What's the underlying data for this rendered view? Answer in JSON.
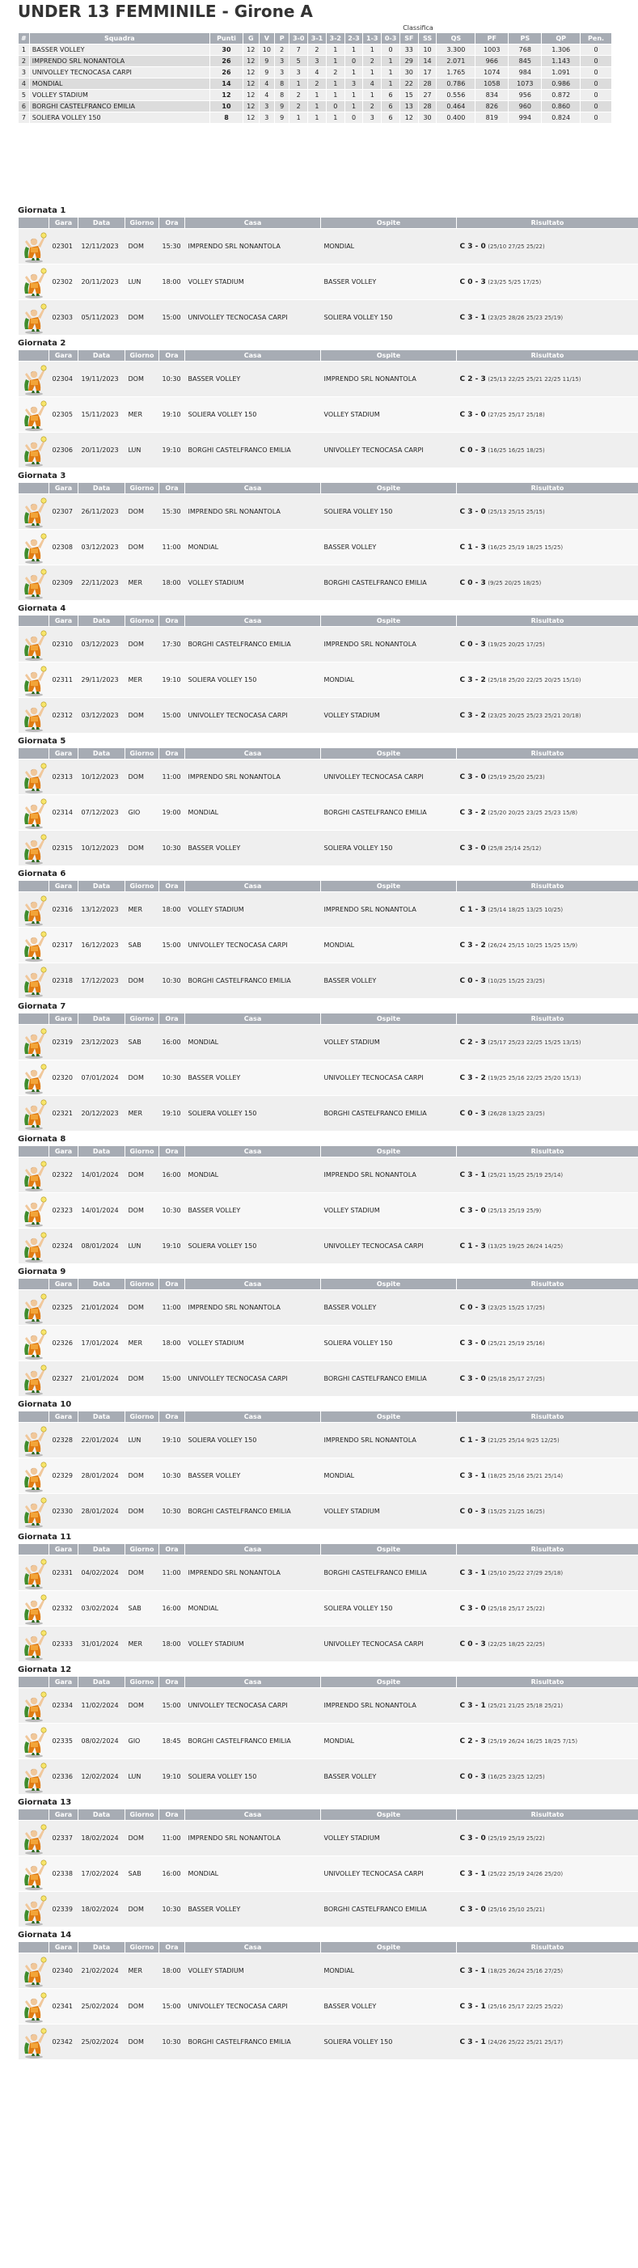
{
  "title": "UNDER 13 FEMMINILE - Girone A",
  "classifica_label": "Classifica",
  "standings_headers": [
    "#",
    "Squadra",
    "Punti",
    "G",
    "V",
    "P",
    "3-0",
    "3-1",
    "3-2",
    "2-3",
    "1-3",
    "0-3",
    "SF",
    "SS",
    "QS",
    "PF",
    "PS",
    "QP",
    "Pen."
  ],
  "standings": [
    [
      "1",
      "BASSER VOLLEY",
      "30",
      "12",
      "10",
      "2",
      "7",
      "2",
      "1",
      "1",
      "1",
      "0",
      "33",
      "10",
      "3.300",
      "1003",
      "768",
      "1.306",
      "0"
    ],
    [
      "2",
      "IMPRENDO SRL NONANTOLA",
      "26",
      "12",
      "9",
      "3",
      "5",
      "3",
      "1",
      "0",
      "2",
      "1",
      "29",
      "14",
      "2.071",
      "966",
      "845",
      "1.143",
      "0"
    ],
    [
      "3",
      "UNIVOLLEY TECNOCASA CARPI",
      "26",
      "12",
      "9",
      "3",
      "3",
      "4",
      "2",
      "1",
      "1",
      "1",
      "30",
      "17",
      "1.765",
      "1074",
      "984",
      "1.091",
      "0"
    ],
    [
      "4",
      "MONDIAL",
      "14",
      "12",
      "4",
      "8",
      "1",
      "2",
      "1",
      "3",
      "4",
      "1",
      "22",
      "28",
      "0.786",
      "1058",
      "1073",
      "0.986",
      "0"
    ],
    [
      "5",
      "VOLLEY STADIUM",
      "12",
      "12",
      "4",
      "8",
      "2",
      "1",
      "1",
      "1",
      "1",
      "6",
      "15",
      "27",
      "0.556",
      "834",
      "956",
      "0.872",
      "0"
    ],
    [
      "6",
      "BORGHI CASTELFRANCO EMILIA",
      "10",
      "12",
      "3",
      "9",
      "2",
      "1",
      "0",
      "1",
      "2",
      "6",
      "13",
      "28",
      "0.464",
      "826",
      "960",
      "0.860",
      "0"
    ],
    [
      "7",
      "SOLIERA VOLLEY 150",
      "8",
      "12",
      "3",
      "9",
      "1",
      "1",
      "1",
      "0",
      "3",
      "6",
      "12",
      "30",
      "0.400",
      "819",
      "994",
      "0.824",
      "0"
    ]
  ],
  "game_headers": [
    "Gara",
    "Data",
    "Giorno",
    "Ora",
    "Casa",
    "Ospite",
    "Risultato"
  ],
  "icon": "volleyball-player-icon",
  "rounds": [
    {
      "title": "Giornata 1",
      "games": [
        [
          "02301",
          "12/11/2023",
          "DOM",
          "15:30",
          "IMPRENDO SRL NONANTOLA",
          "MONDIAL",
          "C 3 - 0",
          "(25/10 27/25 25/22)"
        ],
        [
          "02302",
          "20/11/2023",
          "LUN",
          "18:00",
          "VOLLEY STADIUM",
          "BASSER VOLLEY",
          "C 0 - 3",
          "(23/25 5/25 17/25)"
        ],
        [
          "02303",
          "05/11/2023",
          "DOM",
          "15:00",
          "UNIVOLLEY TECNOCASA CARPI",
          "SOLIERA VOLLEY 150",
          "C 3 - 1",
          "(23/25 28/26 25/23 25/19)"
        ]
      ]
    },
    {
      "title": "Giornata 2",
      "games": [
        [
          "02304",
          "19/11/2023",
          "DOM",
          "10:30",
          "BASSER VOLLEY",
          "IMPRENDO SRL NONANTOLA",
          "C 2 - 3",
          "(25/13 22/25 25/21 22/25 11/15)"
        ],
        [
          "02305",
          "15/11/2023",
          "MER",
          "19:10",
          "SOLIERA VOLLEY 150",
          "VOLLEY STADIUM",
          "C 3 - 0",
          "(27/25 25/17 25/18)"
        ],
        [
          "02306",
          "20/11/2023",
          "LUN",
          "19:10",
          "BORGHI CASTELFRANCO EMILIA",
          "UNIVOLLEY TECNOCASA CARPI",
          "C 0 - 3",
          "(16/25 16/25 18/25)"
        ]
      ]
    },
    {
      "title": "Giornata 3",
      "games": [
        [
          "02307",
          "26/11/2023",
          "DOM",
          "15:30",
          "IMPRENDO SRL NONANTOLA",
          "SOLIERA VOLLEY 150",
          "C 3 - 0",
          "(25/13 25/15 25/15)"
        ],
        [
          "02308",
          "03/12/2023",
          "DOM",
          "11:00",
          "MONDIAL",
          "BASSER VOLLEY",
          "C 1 - 3",
          "(16/25 25/19 18/25 15/25)"
        ],
        [
          "02309",
          "22/11/2023",
          "MER",
          "18:00",
          "VOLLEY STADIUM",
          "BORGHI CASTELFRANCO EMILIA",
          "C 0 - 3",
          "(9/25 20/25 18/25)"
        ]
      ]
    },
    {
      "title": "Giornata 4",
      "games": [
        [
          "02310",
          "03/12/2023",
          "DOM",
          "17:30",
          "BORGHI CASTELFRANCO EMILIA",
          "IMPRENDO SRL NONANTOLA",
          "C 0 - 3",
          "(19/25 20/25 17/25)"
        ],
        [
          "02311",
          "29/11/2023",
          "MER",
          "19:10",
          "SOLIERA VOLLEY 150",
          "MONDIAL",
          "C 3 - 2",
          "(25/18 25/20 22/25 20/25 15/10)"
        ],
        [
          "02312",
          "03/12/2023",
          "DOM",
          "15:00",
          "UNIVOLLEY TECNOCASA CARPI",
          "VOLLEY STADIUM",
          "C 3 - 2",
          "(23/25 20/25 25/23 25/21 20/18)"
        ]
      ]
    },
    {
      "title": "Giornata 5",
      "games": [
        [
          "02313",
          "10/12/2023",
          "DOM",
          "11:00",
          "IMPRENDO SRL NONANTOLA",
          "UNIVOLLEY TECNOCASA CARPI",
          "C 3 - 0",
          "(25/19 25/20 25/23)"
        ],
        [
          "02314",
          "07/12/2023",
          "GIO",
          "19:00",
          "MONDIAL",
          "BORGHI CASTELFRANCO EMILIA",
          "C 3 - 2",
          "(25/20 20/25 23/25 25/23 15/8)"
        ],
        [
          "02315",
          "10/12/2023",
          "DOM",
          "10:30",
          "BASSER VOLLEY",
          "SOLIERA VOLLEY 150",
          "C 3 - 0",
          "(25/8 25/14 25/12)"
        ]
      ]
    },
    {
      "title": "Giornata 6",
      "games": [
        [
          "02316",
          "13/12/2023",
          "MER",
          "18:00",
          "VOLLEY STADIUM",
          "IMPRENDO SRL NONANTOLA",
          "C 1 - 3",
          "(25/14 18/25 13/25 10/25)"
        ],
        [
          "02317",
          "16/12/2023",
          "SAB",
          "15:00",
          "UNIVOLLEY TECNOCASA CARPI",
          "MONDIAL",
          "C 3 - 2",
          "(26/24 25/15 10/25 15/25 15/9)"
        ],
        [
          "02318",
          "17/12/2023",
          "DOM",
          "10:30",
          "BORGHI CASTELFRANCO EMILIA",
          "BASSER VOLLEY",
          "C 0 - 3",
          "(10/25 15/25 23/25)"
        ]
      ]
    },
    {
      "title": "Giornata 7",
      "games": [
        [
          "02319",
          "23/12/2023",
          "SAB",
          "16:00",
          "MONDIAL",
          "VOLLEY STADIUM",
          "C 2 - 3",
          "(25/17 25/23 22/25 15/25 13/15)"
        ],
        [
          "02320",
          "07/01/2024",
          "DOM",
          "10:30",
          "BASSER VOLLEY",
          "UNIVOLLEY TECNOCASA CARPI",
          "C 3 - 2",
          "(19/25 25/16 22/25 25/20 15/13)"
        ],
        [
          "02321",
          "20/12/2023",
          "MER",
          "19:10",
          "SOLIERA VOLLEY 150",
          "BORGHI CASTELFRANCO EMILIA",
          "C 0 - 3",
          "(26/28 13/25 23/25)"
        ]
      ]
    },
    {
      "title": "Giornata 8",
      "games": [
        [
          "02322",
          "14/01/2024",
          "DOM",
          "16:00",
          "MONDIAL",
          "IMPRENDO SRL NONANTOLA",
          "C 3 - 1",
          "(25/21 15/25 25/19 25/14)"
        ],
        [
          "02323",
          "14/01/2024",
          "DOM",
          "10:30",
          "BASSER VOLLEY",
          "VOLLEY STADIUM",
          "C 3 - 0",
          "(25/13 25/19 25/9)"
        ],
        [
          "02324",
          "08/01/2024",
          "LUN",
          "19:10",
          "SOLIERA VOLLEY 150",
          "UNIVOLLEY TECNOCASA CARPI",
          "C 1 - 3",
          "(13/25 19/25 26/24 14/25)"
        ]
      ]
    },
    {
      "title": "Giornata 9",
      "games": [
        [
          "02325",
          "21/01/2024",
          "DOM",
          "11:00",
          "IMPRENDO SRL NONANTOLA",
          "BASSER VOLLEY",
          "C 0 - 3",
          "(23/25 15/25 17/25)"
        ],
        [
          "02326",
          "17/01/2024",
          "MER",
          "18:00",
          "VOLLEY STADIUM",
          "SOLIERA VOLLEY 150",
          "C 3 - 0",
          "(25/21 25/19 25/16)"
        ],
        [
          "02327",
          "21/01/2024",
          "DOM",
          "15:00",
          "UNIVOLLEY TECNOCASA CARPI",
          "BORGHI CASTELFRANCO EMILIA",
          "C 3 - 0",
          "(25/18 25/17 27/25)"
        ]
      ]
    },
    {
      "title": "Giornata 10",
      "games": [
        [
          "02328",
          "22/01/2024",
          "LUN",
          "19:10",
          "SOLIERA VOLLEY 150",
          "IMPRENDO SRL NONANTOLA",
          "C 1 - 3",
          "(21/25 25/14 9/25 12/25)"
        ],
        [
          "02329",
          "28/01/2024",
          "DOM",
          "10:30",
          "BASSER VOLLEY",
          "MONDIAL",
          "C 3 - 1",
          "(18/25 25/16 25/21 25/14)"
        ],
        [
          "02330",
          "28/01/2024",
          "DOM",
          "10:30",
          "BORGHI CASTELFRANCO EMILIA",
          "VOLLEY STADIUM",
          "C 0 - 3",
          "(15/25 21/25 16/25)"
        ]
      ]
    },
    {
      "title": "Giornata 11",
      "games": [
        [
          "02331",
          "04/02/2024",
          "DOM",
          "11:00",
          "IMPRENDO SRL NONANTOLA",
          "BORGHI CASTELFRANCO EMILIA",
          "C 3 - 1",
          "(25/10 25/22 27/29 25/18)"
        ],
        [
          "02332",
          "03/02/2024",
          "SAB",
          "16:00",
          "MONDIAL",
          "SOLIERA VOLLEY 150",
          "C 3 - 0",
          "(25/18 25/17 25/22)"
        ],
        [
          "02333",
          "31/01/2024",
          "MER",
          "18:00",
          "VOLLEY STADIUM",
          "UNIVOLLEY TECNOCASA CARPI",
          "C 0 - 3",
          "(22/25 18/25 22/25)"
        ]
      ]
    },
    {
      "title": "Giornata 12",
      "games": [
        [
          "02334",
          "11/02/2024",
          "DOM",
          "15:00",
          "UNIVOLLEY TECNOCASA CARPI",
          "IMPRENDO SRL NONANTOLA",
          "C 3 - 1",
          "(25/21 21/25 25/18 25/21)"
        ],
        [
          "02335",
          "08/02/2024",
          "GIO",
          "18:45",
          "BORGHI CASTELFRANCO EMILIA",
          "MONDIAL",
          "C 2 - 3",
          "(25/19 26/24 16/25 18/25 7/15)"
        ],
        [
          "02336",
          "12/02/2024",
          "LUN",
          "19:10",
          "SOLIERA VOLLEY 150",
          "BASSER VOLLEY",
          "C 0 - 3",
          "(16/25 23/25 12/25)"
        ]
      ]
    },
    {
      "title": "Giornata 13",
      "games": [
        [
          "02337",
          "18/02/2024",
          "DOM",
          "11:00",
          "IMPRENDO SRL NONANTOLA",
          "VOLLEY STADIUM",
          "C 3 - 0",
          "(25/19 25/19 25/22)"
        ],
        [
          "02338",
          "17/02/2024",
          "SAB",
          "16:00",
          "MONDIAL",
          "UNIVOLLEY TECNOCASA CARPI",
          "C 3 - 1",
          "(25/22 25/19 24/26 25/20)"
        ],
        [
          "02339",
          "18/02/2024",
          "DOM",
          "10:30",
          "BASSER VOLLEY",
          "BORGHI CASTELFRANCO EMILIA",
          "C 3 - 0",
          "(25/16 25/10 25/21)"
        ]
      ]
    },
    {
      "title": "Giornata 14",
      "games": [
        [
          "02340",
          "21/02/2024",
          "MER",
          "18:00",
          "VOLLEY STADIUM",
          "MONDIAL",
          "C 3 - 1",
          "(18/25 26/24 25/16 27/25)"
        ],
        [
          "02341",
          "25/02/2024",
          "DOM",
          "15:00",
          "UNIVOLLEY TECNOCASA CARPI",
          "BASSER VOLLEY",
          "C 3 - 1",
          "(25/16 25/17 22/25 25/22)"
        ],
        [
          "02342",
          "25/02/2024",
          "DOM",
          "10:30",
          "BORGHI CASTELFRANCO EMILIA",
          "SOLIERA VOLLEY 150",
          "C 3 - 1",
          "(24/26 25/22 25/21 25/17)"
        ]
      ]
    }
  ]
}
